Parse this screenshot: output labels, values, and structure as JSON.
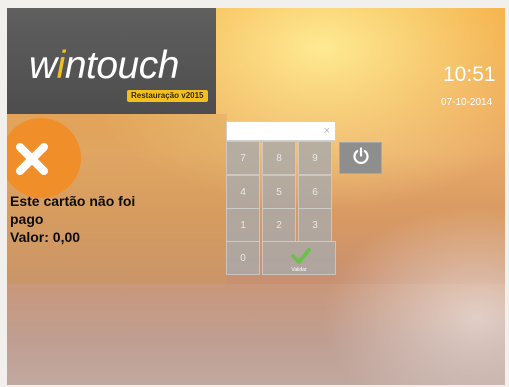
{
  "brand": {
    "name_part1": "w",
    "name_dot": "i",
    "name_part2": "ntouch",
    "edition": "Restauração v2015"
  },
  "clock": {
    "time": "10:51",
    "date": "07-10-2014"
  },
  "message": {
    "line1": "Este cartão não foi",
    "line2": "pago",
    "line3": "Valor: 0,00"
  },
  "display": {
    "value": "",
    "clear_symbol": "×"
  },
  "keypad": {
    "rows": [
      [
        "7",
        "8",
        "9"
      ],
      [
        "4",
        "5",
        "6"
      ],
      [
        "1",
        "2",
        "3"
      ]
    ],
    "zero": "0",
    "confirm_label": "Validar"
  },
  "colors": {
    "accent_orange": "#f08f2a",
    "logo_bg": "#555555",
    "edition_badge": "#f3c11d",
    "confirm_green": "#6cc04a"
  },
  "icons": {
    "error": "x-icon",
    "confirm": "check-icon",
    "power": "power-icon"
  }
}
